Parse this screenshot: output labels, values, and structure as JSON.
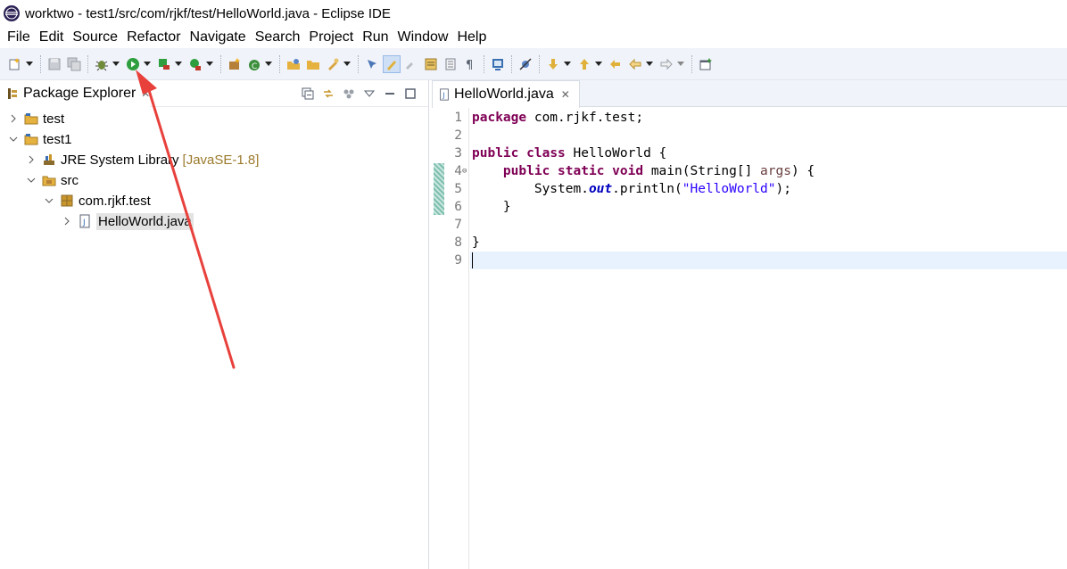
{
  "window": {
    "title": "worktwo - test1/src/com/rjkf/test/HelloWorld.java - Eclipse IDE"
  },
  "menu": [
    "File",
    "Edit",
    "Source",
    "Refactor",
    "Navigate",
    "Search",
    "Project",
    "Run",
    "Window",
    "Help"
  ],
  "explorer": {
    "title": "Package Explorer",
    "close_glyph": "✕",
    "tree": [
      {
        "label": "test",
        "decoration": ""
      },
      {
        "label": "test1",
        "decoration": ""
      },
      {
        "label": "JRE System Library",
        "decoration": "[JavaSE-1.8]"
      },
      {
        "label": "src",
        "decoration": ""
      },
      {
        "label": "com.rjkf.test",
        "decoration": ""
      },
      {
        "label": "HelloWorld.java",
        "decoration": ""
      }
    ]
  },
  "editor": {
    "tab_label": "HelloWorld.java",
    "close_glyph": "✕",
    "line_numbers": [
      "1",
      "2",
      "3",
      "4",
      "5",
      "6",
      "7",
      "8",
      "9"
    ],
    "lines": {
      "l1_kw": "package",
      "l1_rest": " com.rjkf.test;",
      "l3_kw1": "public",
      "l3_kw2": "class",
      "l3_rest": " HelloWorld {",
      "l4_indent": "    ",
      "l4_kw1": "public",
      "l4_kw2": "static",
      "l4_kw3": "void",
      "l4_rest": " main(String[] ",
      "l4_param": "args",
      "l4_end": ") {",
      "l5_start": "        System.",
      "l5_field": "out",
      "l5_mid": ".println(",
      "l5_str": "\"HelloWorld\"",
      "l5_end": ");",
      "l6": "    }",
      "l8": "}"
    }
  },
  "colors": {
    "keyword": "#7f0055",
    "string": "#2a00ff",
    "annotation_arrow": "#e8413c"
  }
}
